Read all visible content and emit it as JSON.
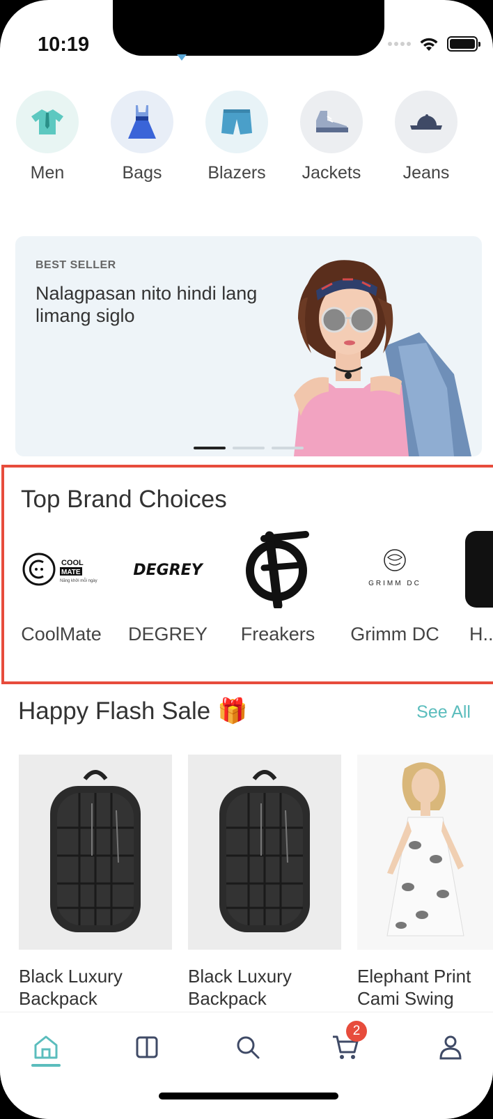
{
  "status_bar": {
    "time": "10:19"
  },
  "categories": [
    {
      "label": "Men",
      "icon": "shirt-icon",
      "bg": "#e8f5f3"
    },
    {
      "label": "Bags",
      "icon": "dress-icon",
      "bg": "#e8eef7"
    },
    {
      "label": "Blazers",
      "icon": "shorts-icon",
      "bg": "#e8f3f7"
    },
    {
      "label": "Jackets",
      "icon": "sneaker-icon",
      "bg": "#eceef1"
    },
    {
      "label": "Jeans",
      "icon": "cap-icon",
      "bg": "#eceef1"
    }
  ],
  "banner": {
    "kicker": "BEST SELLER",
    "title": "Nalagpasan nito hindi lang limang siglo"
  },
  "brands": {
    "title": "Top Brand Choices",
    "items": [
      {
        "label": "CoolMate",
        "logo_text": "COOL",
        "logo_text2": "MATE",
        "tagline": "Năng khởi mỗi ngày"
      },
      {
        "label": "DEGREY",
        "logo_text": "DEGREY"
      },
      {
        "label": "Freakers"
      },
      {
        "label": "Grimm DC",
        "logo_text": "GRIMM  DC"
      },
      {
        "label": "H..."
      }
    ]
  },
  "flash_sale": {
    "title": "Happy Flash Sale 🎁",
    "see_all": "See All",
    "products": [
      {
        "name": "Black Luxury Backpack"
      },
      {
        "name": "Black Luxury Backpack"
      },
      {
        "name": "Elephant Print Cami Swing"
      }
    ]
  },
  "tabbar": {
    "cart_badge": "2",
    "accent": "#5bbdbd",
    "items": [
      "home-icon",
      "catalog-icon",
      "search-icon",
      "cart-icon",
      "profile-icon"
    ]
  },
  "colors": {
    "accent": "#5bbdbd",
    "highlight": "#e74c3c"
  }
}
